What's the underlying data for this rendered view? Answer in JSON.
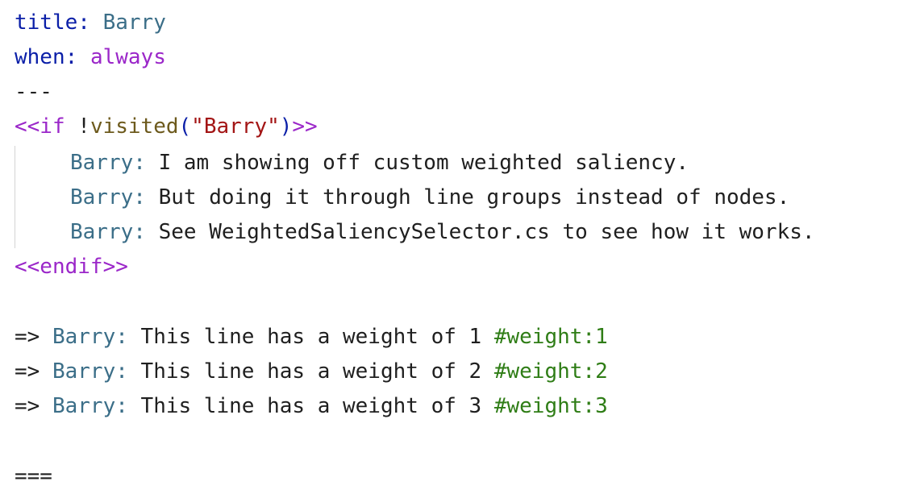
{
  "cut_line": "//////////////",
  "header": {
    "title_key": "title:",
    "title_value": "Barry",
    "when_key": "when:",
    "when_value": "always",
    "separator": "---"
  },
  "if_block": {
    "open_prefix": "<<if ",
    "bang": "!",
    "func": "visited",
    "paren_open": "(",
    "arg": "\"Barry\"",
    "paren_close": ")",
    "open_suffix": ">>",
    "lines": [
      {
        "speaker": "Barry:",
        "text": " I am showing off custom weighted saliency."
      },
      {
        "speaker": "Barry:",
        "text": " But doing it through line groups instead of nodes."
      },
      {
        "speaker": "Barry:",
        "text": " See WeightedSaliencySelector.cs to see how it works."
      }
    ],
    "close": "<<endif>>"
  },
  "line_group": [
    {
      "arrow": "=> ",
      "speaker": "Barry:",
      "text": " This line has a weight of 1 ",
      "tag": "#weight:1"
    },
    {
      "arrow": "=> ",
      "speaker": "Barry:",
      "text": " This line has a weight of 2 ",
      "tag": "#weight:2"
    },
    {
      "arrow": "=> ",
      "speaker": "Barry:",
      "text": " This line has a weight of 3 ",
      "tag": "#weight:3"
    }
  ],
  "end_marker": "==="
}
